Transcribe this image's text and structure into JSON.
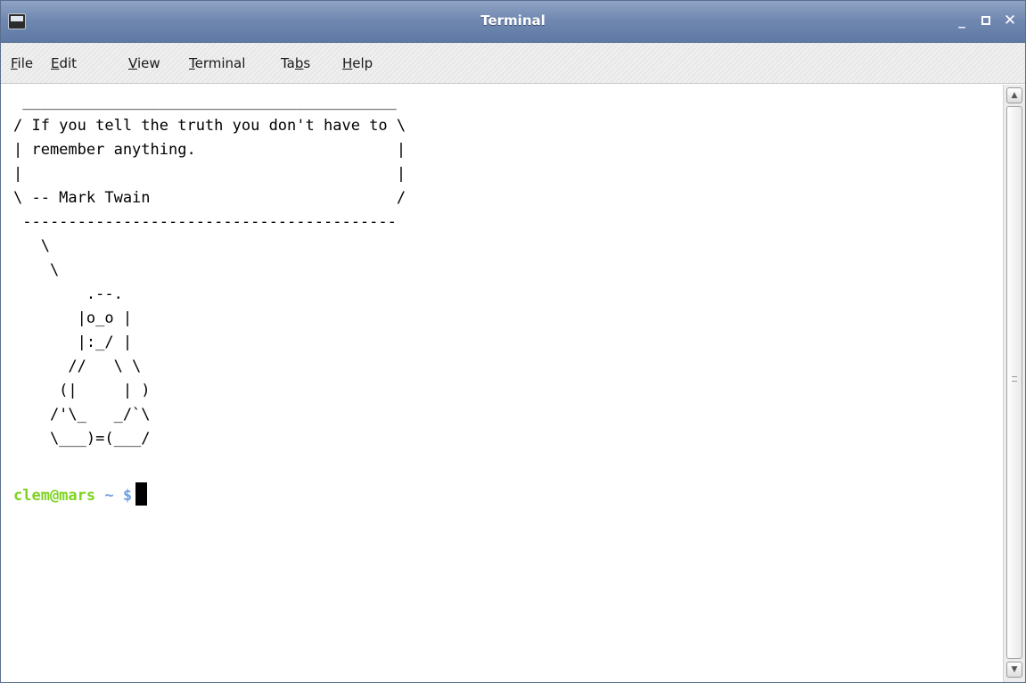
{
  "window": {
    "title": "Terminal",
    "controls": {
      "minimize": "_",
      "close": "✕"
    }
  },
  "menubar": {
    "items": [
      {
        "label_pre": "",
        "label_key": "F",
        "label_post": "ile"
      },
      {
        "label_pre": "",
        "label_key": "E",
        "label_post": "dit"
      },
      {
        "label_pre": "",
        "label_key": "V",
        "label_post": "iew"
      },
      {
        "label_pre": "",
        "label_key": "T",
        "label_post": "erminal"
      },
      {
        "label_pre": "Ta",
        "label_key": "b",
        "label_post": "s"
      },
      {
        "label_pre": "",
        "label_key": "H",
        "label_post": "elp"
      }
    ]
  },
  "terminal": {
    "output": " _________________________________________\n/ If you tell the truth you don't have to \\\n| remember anything.                      |\n|                                         |\n\\ -- Mark Twain                           /\n -----------------------------------------\n   \\\n    \\\n        .--.\n       |o_o |\n       |:_/ |\n      //   \\ \\\n     (|     | )\n    /'\\_   _/`\\\n    \\___)=(___/",
    "prompt_user": "clem@mars",
    "prompt_path": "~",
    "prompt_symbol": "$"
  },
  "scrollbar": {
    "up_arrow": "▲",
    "down_arrow": "▼"
  },
  "colors": {
    "titlebar": "#7189b1",
    "prompt_user": "#7ed321",
    "prompt_path": "#6fa0e0"
  }
}
